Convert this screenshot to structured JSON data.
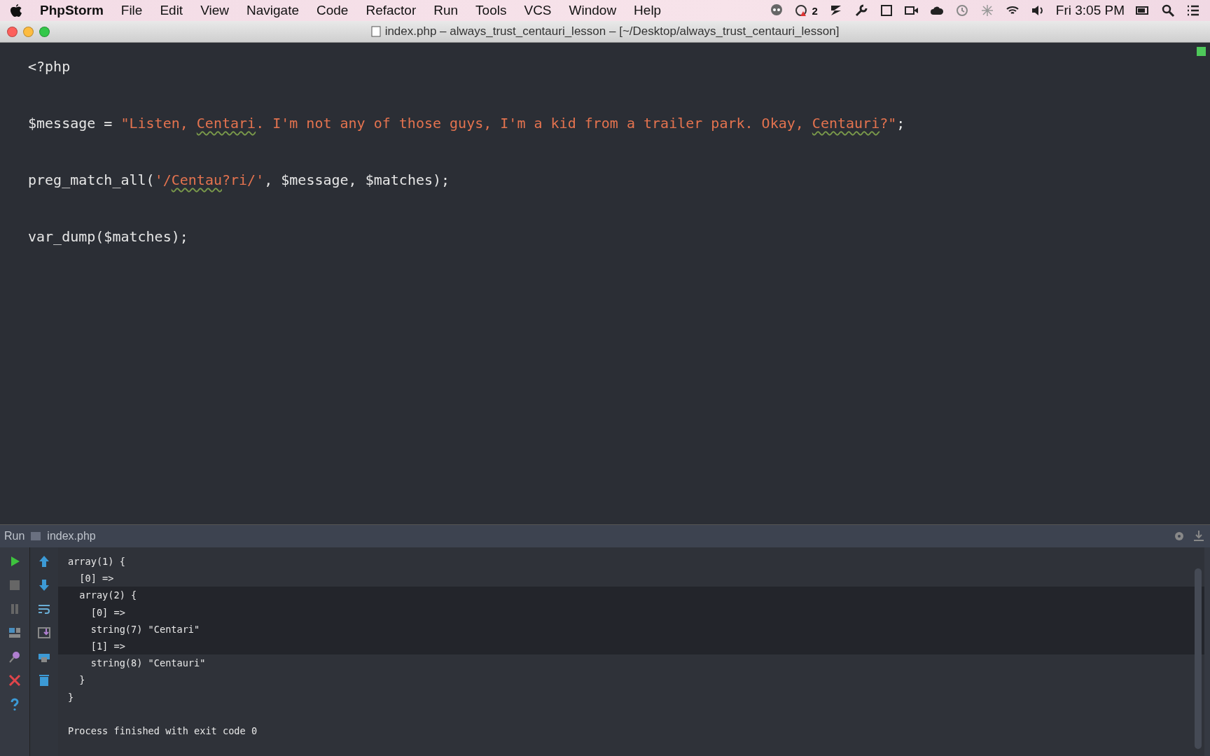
{
  "menu_bar": {
    "app": "PhpStorm",
    "items": [
      "File",
      "Edit",
      "View",
      "Navigate",
      "Code",
      "Refactor",
      "Run",
      "Tools",
      "VCS",
      "Window",
      "Help"
    ],
    "badge": "2",
    "clock": "Fri 3:05 PM"
  },
  "window": {
    "title": "index.php – always_trust_centauri_lesson – [~/Desktop/always_trust_centauri_lesson]"
  },
  "editor": {
    "lines": [
      [
        {
          "kind": "plain",
          "text": "<?php"
        }
      ],
      [
        {
          "kind": "plain",
          "text": "$message = "
        },
        {
          "kind": "string",
          "text": "\"Listen, "
        },
        {
          "kind": "typo",
          "text": "Centari"
        },
        {
          "kind": "string",
          "text": ". I'm not any of those guys, I'm a kid from a trailer park. Okay, "
        },
        {
          "kind": "typo",
          "text": "Centauri"
        },
        {
          "kind": "string",
          "text": "?\""
        },
        {
          "kind": "plain",
          "text": ";"
        }
      ],
      [
        {
          "kind": "plain",
          "text": "preg_match_all("
        },
        {
          "kind": "string",
          "text": "'/"
        },
        {
          "kind": "typo",
          "text": "Centau"
        },
        {
          "kind": "string",
          "text": "?ri/'"
        },
        {
          "kind": "plain",
          "text": ", $message, $matches);"
        }
      ],
      [
        {
          "kind": "plain",
          "text": "var_dump($matches);"
        }
      ]
    ]
  },
  "run_panel": {
    "label": "Run",
    "tab": "index.php",
    "output": [
      {
        "text": "array(1) {",
        "selected": false
      },
      {
        "text": "  [0] =>",
        "selected": false
      },
      {
        "text": "  array(2) {",
        "selected": true
      },
      {
        "text": "    [0] =>",
        "selected": true
      },
      {
        "text": "    string(7) \"Centari\"",
        "selected": true
      },
      {
        "text": "    [1] =>",
        "selected": true
      },
      {
        "text": "    string(8) \"Centauri\"",
        "selected": false
      },
      {
        "text": "  }",
        "selected": false
      },
      {
        "text": "}",
        "selected": false
      },
      {
        "kind": "status",
        "text": "Process finished with exit code 0",
        "selected": false
      }
    ]
  }
}
